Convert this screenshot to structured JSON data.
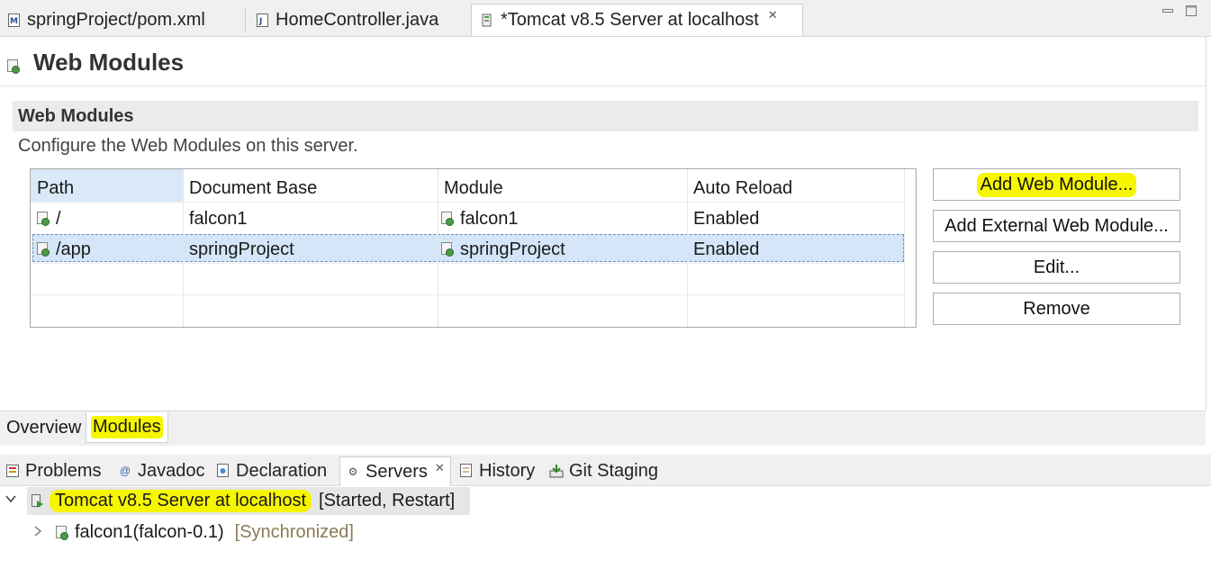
{
  "editor_tabs": [
    {
      "label": "springProject/pom.xml",
      "icon": "maven-file-icon"
    },
    {
      "label": "HomeController.java",
      "icon": "java-file-icon"
    },
    {
      "label": "*Tomcat v8.5 Server at localhost",
      "icon": "server-icon",
      "active": true
    }
  ],
  "page": {
    "title": "Web Modules",
    "section_title": "Web Modules",
    "section_description": "Configure the Web Modules on this server."
  },
  "table": {
    "columns": [
      "Path",
      "Document Base",
      "Module",
      "Auto Reload"
    ],
    "rows": [
      {
        "path": "/",
        "document_base": "falcon1",
        "module": "falcon1",
        "auto_reload": "Enabled"
      },
      {
        "path": "/app",
        "document_base": "springProject",
        "module": "springProject",
        "auto_reload": "Enabled",
        "selected": true
      }
    ]
  },
  "buttons": {
    "add_web_module": "Add Web Module...",
    "add_external_web_module": "Add External Web Module...",
    "edit": "Edit...",
    "remove": "Remove"
  },
  "bottom_tabs": {
    "overview": "Overview",
    "modules": "Modules"
  },
  "view_tabs": [
    {
      "label": "Problems",
      "icon": "problems-icon"
    },
    {
      "label": "Javadoc",
      "icon": "javadoc-icon"
    },
    {
      "label": "Declaration",
      "icon": "declaration-icon"
    },
    {
      "label": "Servers",
      "icon": "servers-icon",
      "active": true
    },
    {
      "label": "History",
      "icon": "history-icon"
    },
    {
      "label": "Git Staging",
      "icon": "git-staging-icon"
    }
  ],
  "servers": {
    "server_name": "Tomcat v8.5 Server at localhost",
    "server_status": "[Started, Restart]",
    "module_name": "falcon1(falcon-0.1)",
    "module_status": "[Synchronized]"
  },
  "colors": {
    "highlight": "#f6f600",
    "selection": "#d4e6f8"
  }
}
